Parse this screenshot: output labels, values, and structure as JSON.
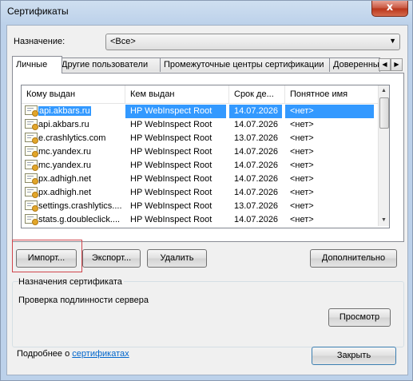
{
  "window": {
    "title": "Сертификаты",
    "close_glyph": "x"
  },
  "purpose": {
    "label": "Назначение:",
    "value": "<Все>"
  },
  "tabs": [
    {
      "label": "Личные",
      "active": true
    },
    {
      "label": "Другие пользователи",
      "active": false
    },
    {
      "label": "Промежуточные центры сертификации",
      "active": false
    },
    {
      "label": "Доверенные",
      "active": false
    }
  ],
  "list": {
    "columns": [
      "Кому выдан",
      "Кем выдан",
      "Срок де...",
      "Понятное имя"
    ],
    "rows": [
      {
        "issued_to": "api.akbars.ru",
        "issued_by": "HP WebInspect Root",
        "expires": "14.07.2026",
        "friendly": "<нет>",
        "selected": true
      },
      {
        "issued_to": "api.akbars.ru",
        "issued_by": "HP WebInspect Root",
        "expires": "14.07.2026",
        "friendly": "<нет>",
        "selected": false
      },
      {
        "issued_to": "e.crashlytics.com",
        "issued_by": "HP WebInspect Root",
        "expires": "13.07.2026",
        "friendly": "<нет>",
        "selected": false
      },
      {
        "issued_to": "mc.yandex.ru",
        "issued_by": "HP WebInspect Root",
        "expires": "14.07.2026",
        "friendly": "<нет>",
        "selected": false
      },
      {
        "issued_to": "mc.yandex.ru",
        "issued_by": "HP WebInspect Root",
        "expires": "14.07.2026",
        "friendly": "<нет>",
        "selected": false
      },
      {
        "issued_to": "px.adhigh.net",
        "issued_by": "HP WebInspect Root",
        "expires": "14.07.2026",
        "friendly": "<нет>",
        "selected": false
      },
      {
        "issued_to": "px.adhigh.net",
        "issued_by": "HP WebInspect Root",
        "expires": "14.07.2026",
        "friendly": "<нет>",
        "selected": false
      },
      {
        "issued_to": "settings.crashlytics....",
        "issued_by": "HP WebInspect Root",
        "expires": "13.07.2026",
        "friendly": "<нет>",
        "selected": false
      },
      {
        "issued_to": "stats.g.doubleclick....",
        "issued_by": "HP WebInspect Root",
        "expires": "14.07.2026",
        "friendly": "<нет>",
        "selected": false
      }
    ]
  },
  "buttons": {
    "import": "Импорт...",
    "export": "Экспорт...",
    "delete": "Удалить",
    "advanced": "Дополнительно",
    "view": "Просмотр",
    "close": "Закрыть"
  },
  "purposes_group": {
    "title": "Назначения сертификата",
    "value": "Проверка подлинности сервера"
  },
  "footer": {
    "text": "Подробнее о ",
    "link": "сертификатах"
  },
  "highlight_color": "#d0454c",
  "selection_color": "#3399ff"
}
